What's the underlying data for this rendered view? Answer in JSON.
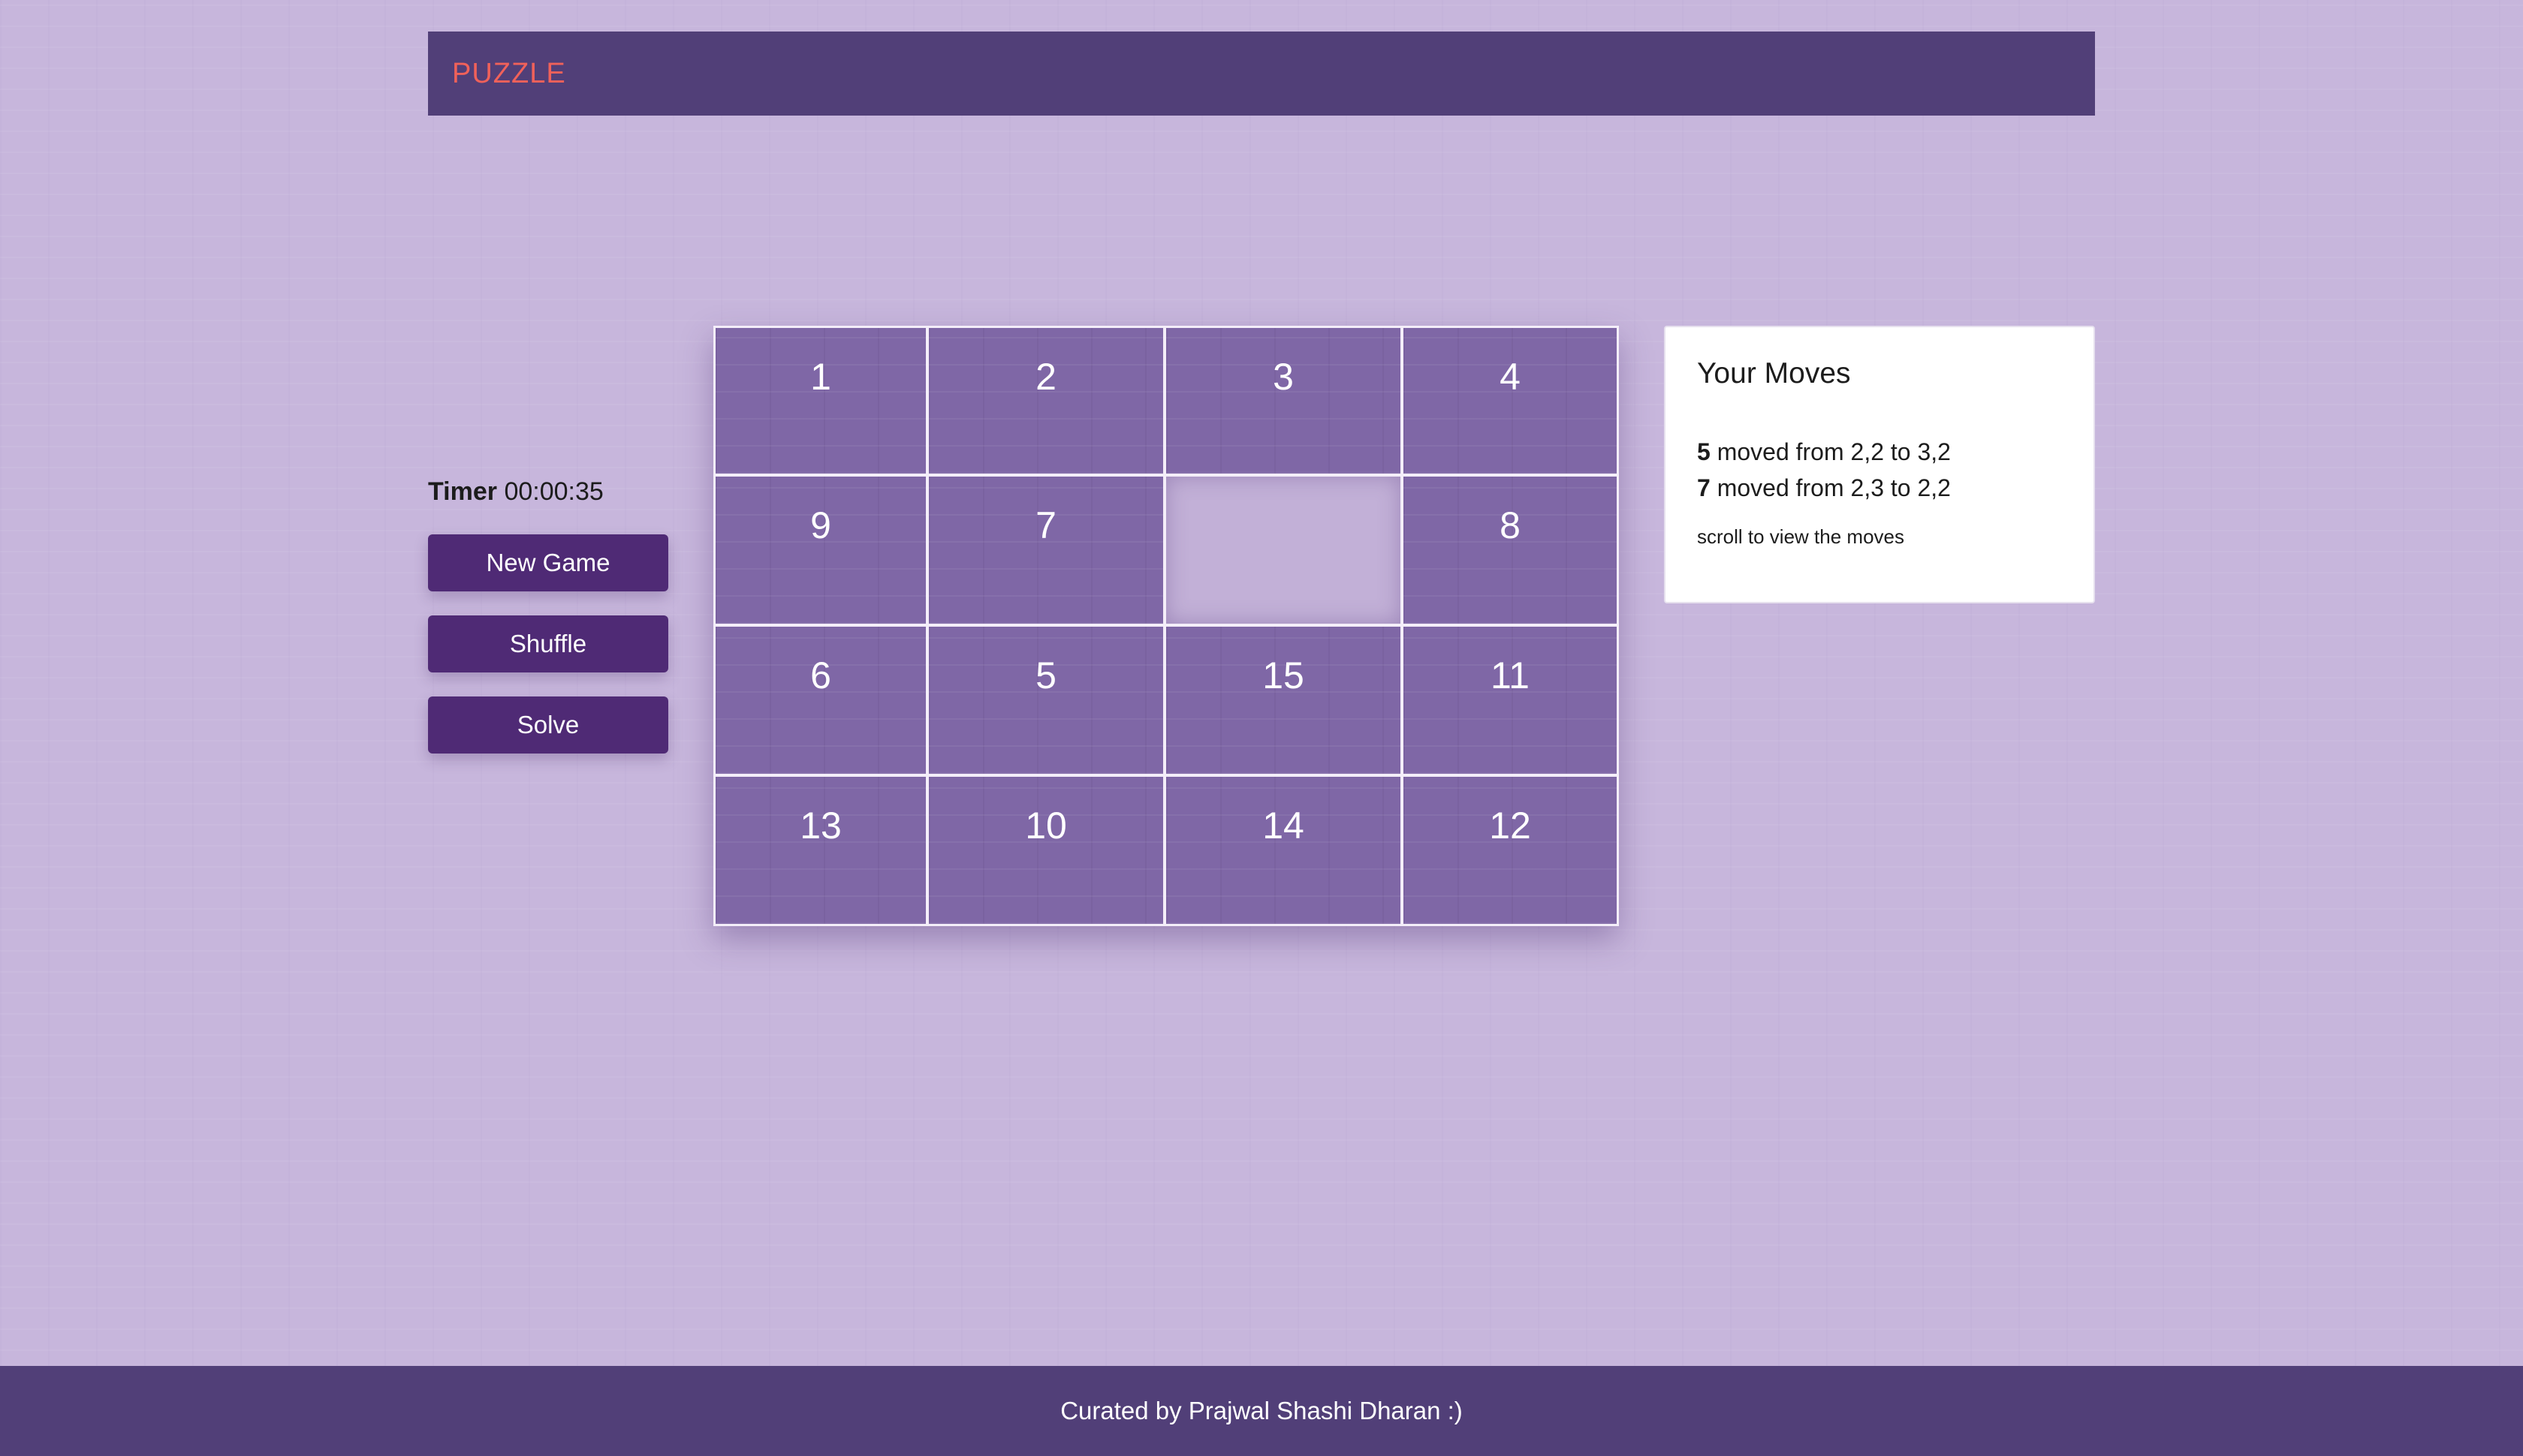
{
  "header": {
    "brand": "PUZZLE"
  },
  "controls": {
    "timer_label": "Timer",
    "timer_value": "00:00:35",
    "new_game_label": "New Game",
    "shuffle_label": "Shuffle",
    "solve_label": "Solve"
  },
  "board": {
    "rows": [
      [
        "1",
        "2",
        "3",
        "4"
      ],
      [
        "9",
        "7",
        "",
        "8"
      ],
      [
        "6",
        "5",
        "15",
        "11"
      ],
      [
        "13",
        "10",
        "14",
        "12"
      ]
    ]
  },
  "moves": {
    "title": "Your Moves",
    "entries": [
      {
        "piece": "5",
        "text": " moved from 2,2 to 3,2"
      },
      {
        "piece": "7",
        "text": " moved from 2,3 to 2,2"
      }
    ],
    "hint": "scroll to view the moves"
  },
  "footer": {
    "text": "Curated by Prajwal Shashi Dharan :)"
  },
  "colors": {
    "background": "#c7b6dc",
    "header_bg": "#513f78",
    "brand": "#f0615a",
    "button_bg": "#4f2a75",
    "tile_bg": "#7f67a6"
  }
}
